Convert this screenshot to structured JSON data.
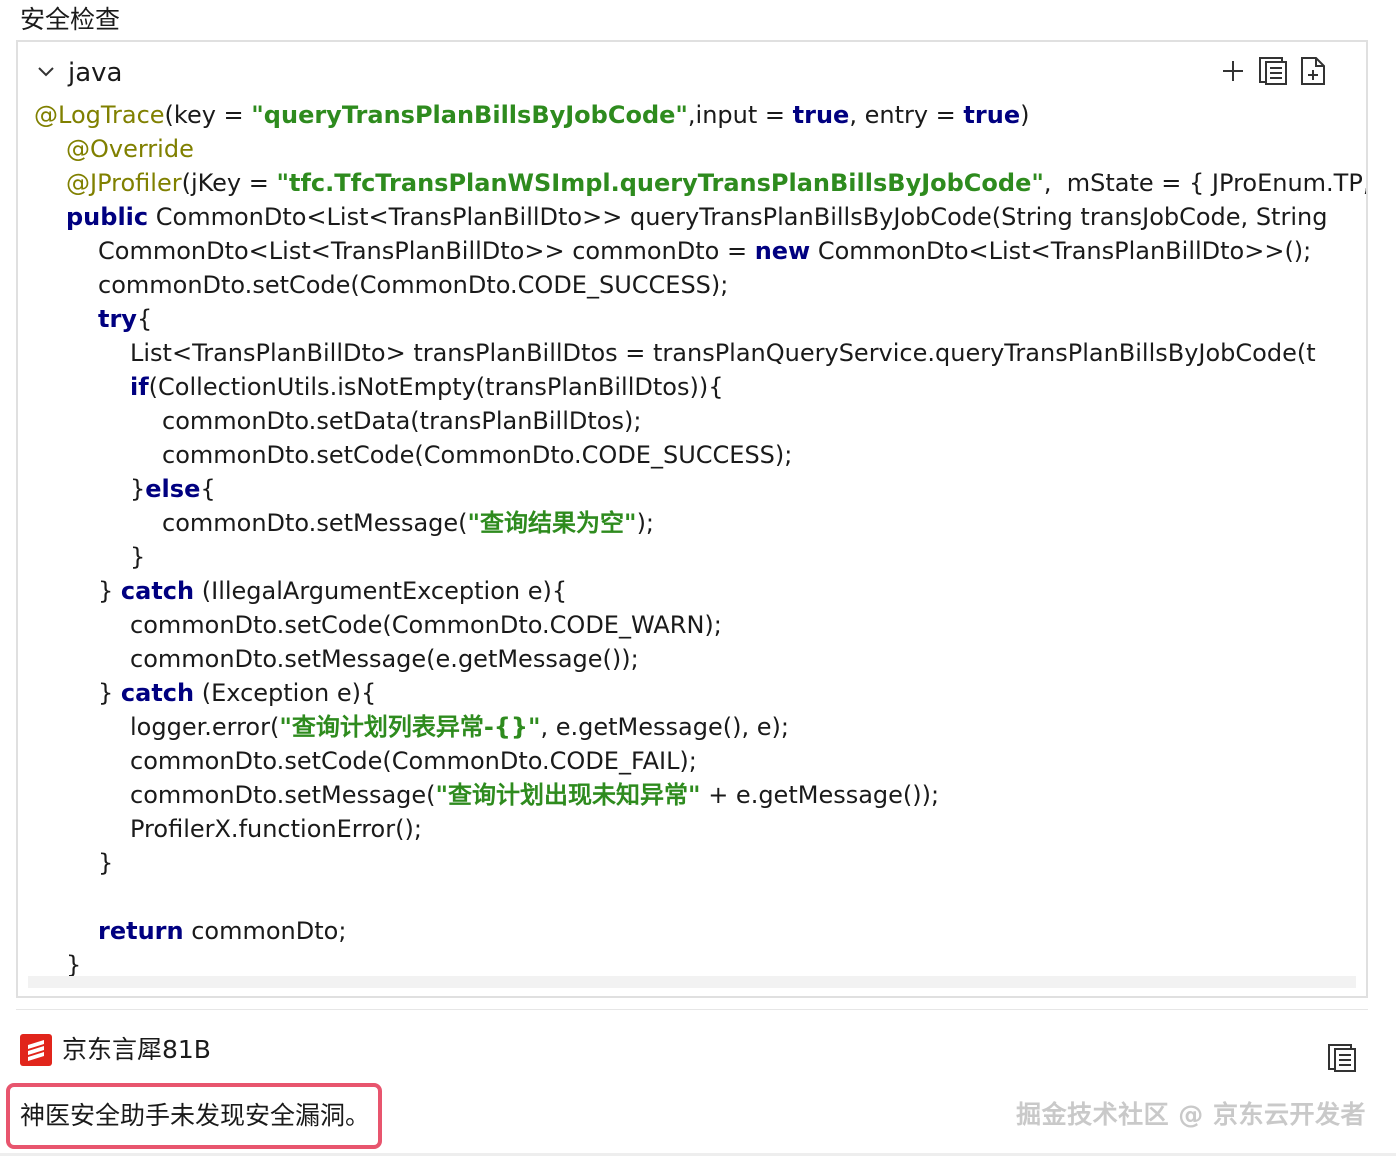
{
  "page": {
    "title": "安全检查"
  },
  "code_block": {
    "language": "java",
    "lines": [
      {
        "indent": 0,
        "tokens": [
          {
            "t": "an",
            "v": "@LogTrace"
          },
          {
            "t": "p",
            "v": "(key = "
          },
          {
            "t": "st",
            "v": "\"queryTransPlanBillsByJobCode\""
          },
          {
            "t": "p",
            "v": ",input = "
          },
          {
            "t": "kw",
            "v": "true"
          },
          {
            "t": "p",
            "v": ", entry = "
          },
          {
            "t": "kw",
            "v": "true"
          },
          {
            "t": "p",
            "v": ")"
          }
        ]
      },
      {
        "indent": 1,
        "tokens": [
          {
            "t": "an",
            "v": "@Override"
          }
        ]
      },
      {
        "indent": 1,
        "tokens": [
          {
            "t": "an",
            "v": "@JProfiler"
          },
          {
            "t": "p",
            "v": "(jKey = "
          },
          {
            "t": "st",
            "v": "\"tfc.TfcTransPlanWSImpl.queryTransPlanBillsByJobCode\""
          },
          {
            "t": "p",
            "v": ",  mState = { JProEnum.TP,"
          }
        ]
      },
      {
        "indent": 1,
        "tokens": [
          {
            "t": "kw",
            "v": "public"
          },
          {
            "t": "p",
            "v": " CommonDto<List<TransPlanBillDto>> queryTransPlanBillsByJobCode(String transJobCode, String"
          }
        ]
      },
      {
        "indent": 2,
        "tokens": [
          {
            "t": "p",
            "v": "CommonDto<List<TransPlanBillDto>> commonDto = "
          },
          {
            "t": "kw",
            "v": "new"
          },
          {
            "t": "p",
            "v": " CommonDto<List<TransPlanBillDto>>();"
          }
        ]
      },
      {
        "indent": 2,
        "tokens": [
          {
            "t": "p",
            "v": "commonDto.setCode(CommonDto.CODE_SUCCESS);"
          }
        ]
      },
      {
        "indent": 2,
        "tokens": [
          {
            "t": "kw",
            "v": "try"
          },
          {
            "t": "p",
            "v": "{"
          }
        ]
      },
      {
        "indent": 3,
        "tokens": [
          {
            "t": "p",
            "v": "List<TransPlanBillDto> transPlanBillDtos = transPlanQueryService.queryTransPlanBillsByJobCode(t"
          }
        ]
      },
      {
        "indent": 3,
        "tokens": [
          {
            "t": "kw",
            "v": "if"
          },
          {
            "t": "p",
            "v": "(CollectionUtils.isNotEmpty(transPlanBillDtos)){"
          }
        ]
      },
      {
        "indent": 4,
        "tokens": [
          {
            "t": "p",
            "v": "commonDto.setData(transPlanBillDtos);"
          }
        ]
      },
      {
        "indent": 4,
        "tokens": [
          {
            "t": "p",
            "v": "commonDto.setCode(CommonDto.CODE_SUCCESS);"
          }
        ]
      },
      {
        "indent": 3,
        "tokens": [
          {
            "t": "p",
            "v": "}"
          },
          {
            "t": "kw",
            "v": "else"
          },
          {
            "t": "p",
            "v": "{"
          }
        ]
      },
      {
        "indent": 4,
        "tokens": [
          {
            "t": "p",
            "v": "commonDto.setMessage("
          },
          {
            "t": "st",
            "v": "\"查询结果为空\""
          },
          {
            "t": "p",
            "v": ");"
          }
        ]
      },
      {
        "indent": 3,
        "tokens": [
          {
            "t": "p",
            "v": "}"
          }
        ]
      },
      {
        "indent": 2,
        "tokens": [
          {
            "t": "p",
            "v": "} "
          },
          {
            "t": "kw",
            "v": "catch"
          },
          {
            "t": "p",
            "v": " (IllegalArgumentException e){"
          }
        ]
      },
      {
        "indent": 3,
        "tokens": [
          {
            "t": "p",
            "v": "commonDto.setCode(CommonDto.CODE_WARN);"
          }
        ]
      },
      {
        "indent": 3,
        "tokens": [
          {
            "t": "p",
            "v": "commonDto.setMessage(e.getMessage());"
          }
        ]
      },
      {
        "indent": 2,
        "tokens": [
          {
            "t": "p",
            "v": "} "
          },
          {
            "t": "kw",
            "v": "catch"
          },
          {
            "t": "p",
            "v": " (Exception e){"
          }
        ]
      },
      {
        "indent": 3,
        "tokens": [
          {
            "t": "p",
            "v": "logger.error("
          },
          {
            "t": "st",
            "v": "\"查询计划列表异常-{}\""
          },
          {
            "t": "p",
            "v": ", e.getMessage(), e);"
          }
        ]
      },
      {
        "indent": 3,
        "tokens": [
          {
            "t": "p",
            "v": "commonDto.setCode(CommonDto.CODE_FAIL);"
          }
        ]
      },
      {
        "indent": 3,
        "tokens": [
          {
            "t": "p",
            "v": "commonDto.setMessage("
          },
          {
            "t": "st",
            "v": "\"查询计划出现未知异常\""
          },
          {
            "t": "p",
            "v": " + e.getMessage());"
          }
        ]
      },
      {
        "indent": 3,
        "tokens": [
          {
            "t": "p",
            "v": "ProfilerX.functionError();"
          }
        ]
      },
      {
        "indent": 2,
        "tokens": [
          {
            "t": "p",
            "v": "}"
          }
        ]
      },
      {
        "indent": 0,
        "tokens": []
      },
      {
        "indent": 2,
        "tokens": [
          {
            "t": "kw",
            "v": "return"
          },
          {
            "t": "p",
            "v": " commonDto;"
          }
        ]
      },
      {
        "indent": 1,
        "tokens": [
          {
            "t": "p",
            "v": "}"
          }
        ]
      }
    ]
  },
  "icons": {
    "collapse": "chevron-down-icon",
    "add": "plus-icon",
    "copy": "copy-icon",
    "insert": "insert-file-icon",
    "brand": "jd-yanxi-logo",
    "copy_result": "copy-icon"
  },
  "colors": {
    "annotation": "#808000",
    "keyword": "#000080",
    "string": "#2e8b1e",
    "highlight_border": "#e8556e",
    "brand_red": "#e1251b"
  },
  "assistant": {
    "name": "京东言犀81B",
    "result": "神医安全助手未发现安全漏洞。"
  },
  "watermark": "掘金技术社区 @ 京东云开发者"
}
